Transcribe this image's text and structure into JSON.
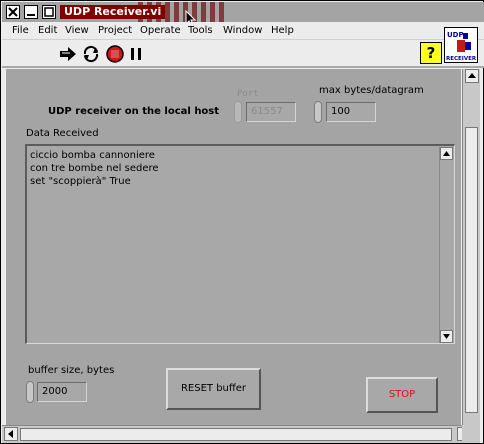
{
  "window": {
    "title": "UDP Receiver.vi"
  },
  "menu": {
    "items": [
      "File",
      "Edit",
      "View",
      "Project",
      "Operate",
      "Tools",
      "Window",
      "Help"
    ]
  },
  "toolbar": {
    "run_icon": "run-arrow-icon",
    "run_continuous_icon": "run-continuously-icon",
    "abort_icon": "abort-icon",
    "pause_icon": "pause-icon",
    "help_label": "?",
    "vi_icon_caption": "UDP",
    "vi_icon_caption2": "RECEIVER"
  },
  "panel": {
    "heading": "UDP receiver on the local host",
    "port": {
      "label": "Port",
      "value": "61557"
    },
    "max_bytes": {
      "label": "max bytes/datagram",
      "value": "100"
    },
    "data_received": {
      "label": "Data Received",
      "lines": "ciccio bomba cannoniere\ncon tre bombe nel sedere\nset \"scoppierà\" True"
    },
    "buffer_size": {
      "label": "buffer size, bytes",
      "value": "2000"
    },
    "reset_button": "RESET buffer",
    "stop_button": "STOP"
  },
  "colors": {
    "panel_bg": "#a4a4a4",
    "title_highlight": "#800000",
    "stop_text": "#e01010",
    "help_bg": "#ffff20"
  }
}
